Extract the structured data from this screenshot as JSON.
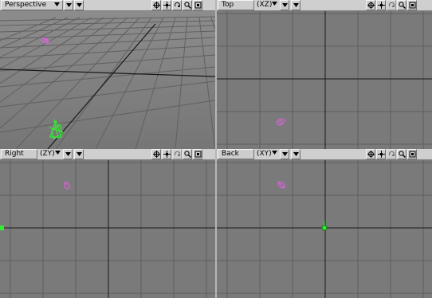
{
  "viewports": {
    "perspective": {
      "view": "Perspective",
      "axes": ""
    },
    "top": {
      "view": "Top",
      "axes": "(XZ)"
    },
    "right": {
      "view": "Right",
      "axes": "(ZY)"
    },
    "back": {
      "view": "Back",
      "axes": "(XY)"
    }
  },
  "toolbar_icons": [
    "crosshair-move-icon",
    "four-arrow-pan-icon",
    "rotate-icon",
    "magnify-icon",
    "maximize-icon"
  ],
  "colors": {
    "grid_bg": "#7a7a7a",
    "grid_line": "#5e5e5e",
    "axis_line": "#1a1a1a",
    "light_object": "#e060e0",
    "selected_object": "#33ee33"
  }
}
